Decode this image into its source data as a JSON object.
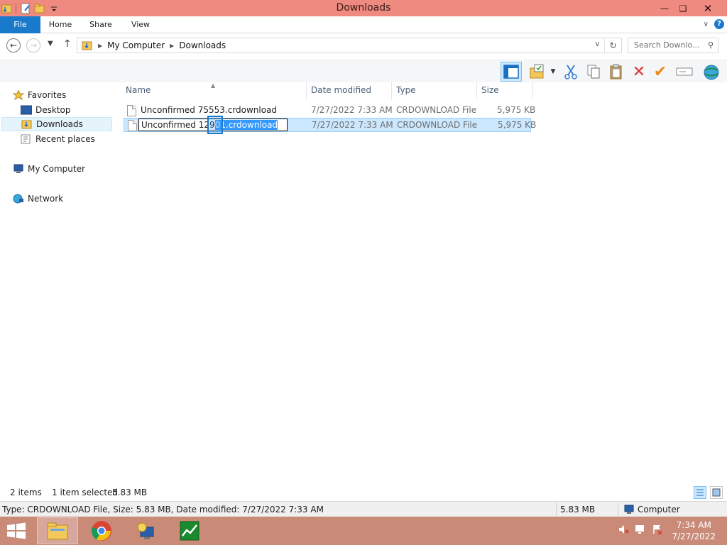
{
  "window": {
    "title": "Downloads"
  },
  "ribbon": {
    "tabs": [
      {
        "label": "File"
      },
      {
        "label": "Home"
      },
      {
        "label": "Share"
      },
      {
        "label": "View"
      }
    ],
    "help_label": "?"
  },
  "address": {
    "crumbs": [
      "My Computer",
      "Downloads"
    ],
    "search_placeholder": "Search Downlo..."
  },
  "navigation": {
    "favorites": "Favorites",
    "desktop": "Desktop",
    "downloads": "Downloads",
    "recent": "Recent places",
    "computer": "My Computer",
    "network": "Network"
  },
  "columns": {
    "name": "Name",
    "date": "Date modified",
    "type": "Type",
    "size": "Size"
  },
  "files": [
    {
      "name": "Unconfirmed 75553.crdownload",
      "date": "7/27/2022 7:33 AM",
      "type": "CRDOWNLOAD File",
      "size": "5,975 KB"
    },
    {
      "name_prefix": "Unconfirmed 129",
      "name_mid": "01",
      "name_sel": ".crdownload",
      "date": "7/27/2022 7:33 AM",
      "type": "CRDOWNLOAD File",
      "size": "5,975 KB"
    }
  ],
  "details": {
    "item_count": "2 items",
    "selection": "1 item selected",
    "selection_size": "5.83 MB"
  },
  "status": {
    "info": "Type: CRDOWNLOAD File, Size: 5.83 MB, Date modified: 7/27/2022 7:33 AM",
    "size": "5.83 MB",
    "location": "Computer"
  },
  "taskbar": {
    "time": "7:34 AM",
    "date": "7/27/2022"
  },
  "colors": {
    "titlebar": "#ee8a80",
    "file_tab": "#1979ca",
    "taskbar": "#c98a78",
    "selection": "#cce8ff"
  }
}
